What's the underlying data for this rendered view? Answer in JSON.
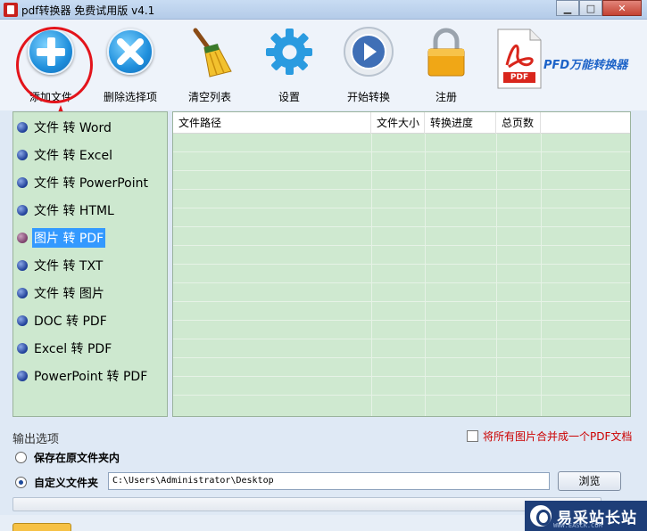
{
  "window": {
    "title": "pdf转换器 免费试用版 v4.1",
    "controls": [
      "minimize",
      "maximize",
      "close"
    ]
  },
  "toolbar": {
    "add_file": "添加文件",
    "remove_selected": "删除选择项",
    "clear_list": "清空列表",
    "settings": "设置",
    "start_convert": "开始转换",
    "register": "注册",
    "brand": "PFD万能转换器",
    "pdf_badge": "PDF"
  },
  "sidebar": {
    "items": [
      {
        "label": "文件 转 Word",
        "selected": false
      },
      {
        "label": "文件 转 Excel",
        "selected": false
      },
      {
        "label": "文件 转 PowerPoint",
        "selected": false
      },
      {
        "label": "文件 转 HTML",
        "selected": false
      },
      {
        "label": "图片 转 PDF",
        "selected": true
      },
      {
        "label": "文件 转 TXT",
        "selected": false
      },
      {
        "label": "文件 转 图片",
        "selected": false
      },
      {
        "label": "DOC 转 PDF",
        "selected": false
      },
      {
        "label": "Excel 转 PDF",
        "selected": false
      },
      {
        "label": "PowerPoint 转 PDF",
        "selected": false
      }
    ]
  },
  "table": {
    "columns": [
      "文件路径",
      "文件大小",
      "转换进度",
      "总页数"
    ],
    "rows": []
  },
  "output": {
    "title": "输出选项",
    "merge_images_label": "将所有图片合并成一个PDF文档",
    "merge_images_checked": false,
    "save_in_source_label": "保存在原文件夹内",
    "custom_folder_label": "自定义文件夹",
    "selected_option": "custom",
    "path_value": "C:\\Users\\Administrator\\Desktop",
    "browse_label": "浏览"
  },
  "watermark": {
    "text": "易采站长站",
    "sub": "WWW.EASCK.COM"
  },
  "colors": {
    "panel_green": "#cde8cf",
    "selection_blue": "#3399ff",
    "annotation_red": "#e3141b",
    "notice_red": "#cc0000"
  }
}
